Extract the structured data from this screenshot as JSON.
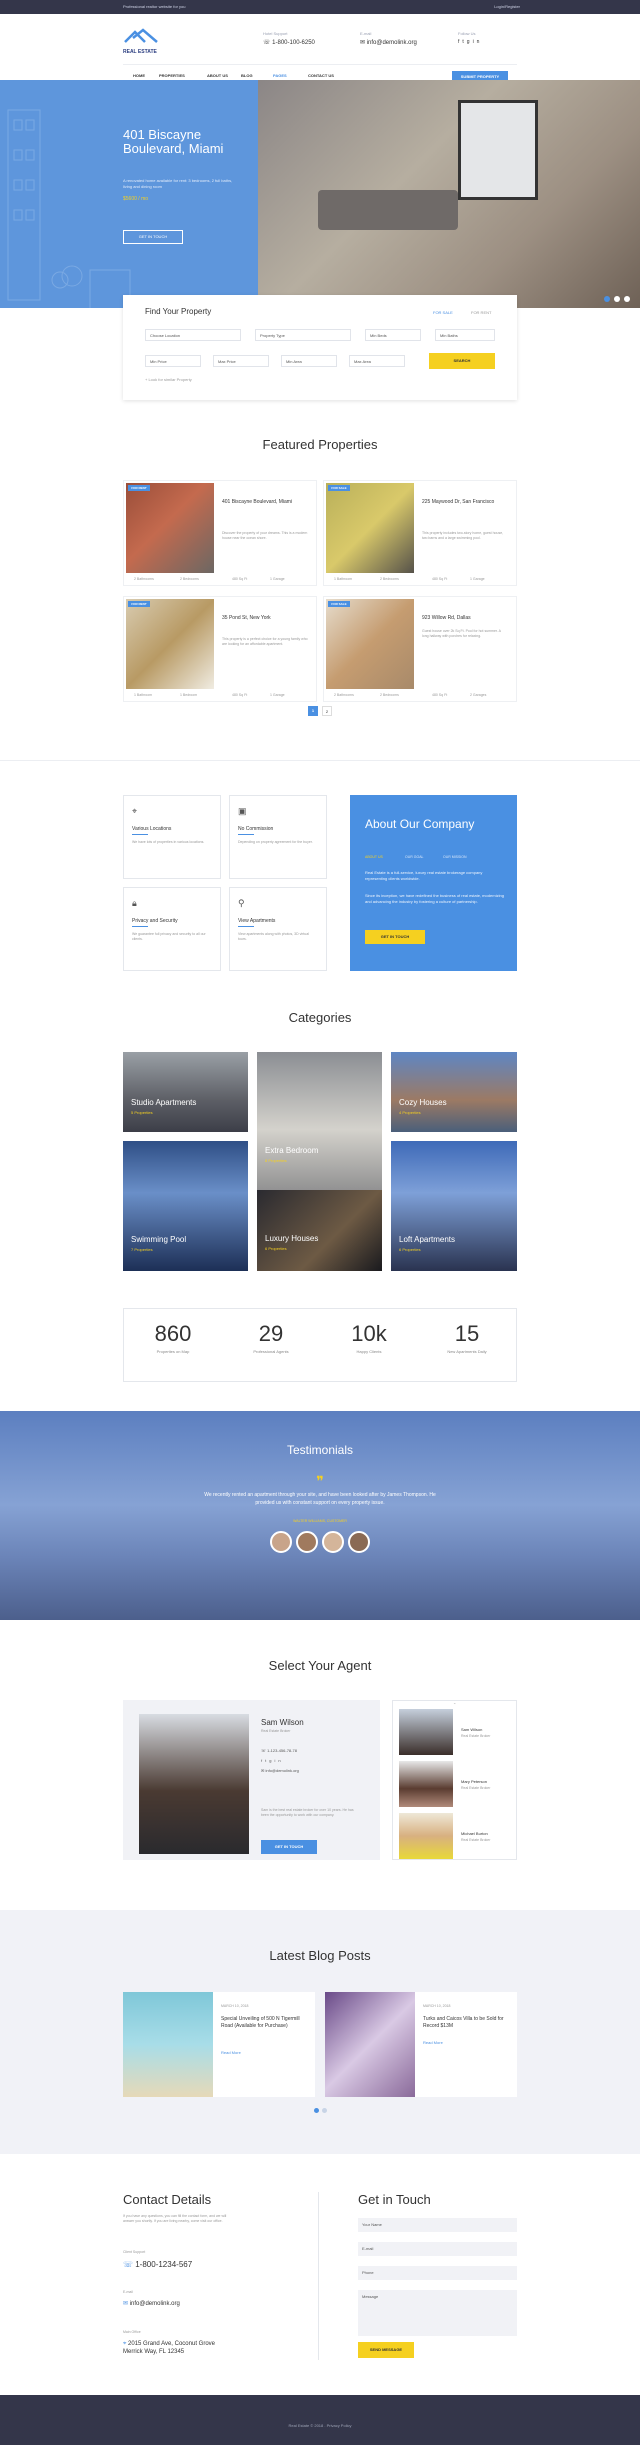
{
  "topbar": {
    "left": "Professional realtor website for you",
    "right": "Login/Register"
  },
  "header": {
    "logo": "REAL ESTATE",
    "phone_label": "Hotel Support",
    "phone": "1-800-100-6250",
    "email_label": "E-mail",
    "email": "info@demolink.org",
    "follow_label": "Follow Us",
    "nav": [
      "HOME",
      "PROPERTIES",
      "ABOUT US",
      "BLOG",
      "PAGES",
      "CONTACT US"
    ],
    "submit_button": "SUBMIT PROPERTY"
  },
  "hero": {
    "title": "401 Biscayne Boulevard, Miami",
    "desc": "A renovated home available for rent: 3 bedrooms, 2 full baths, living and dining room",
    "price": "$5600 / mo",
    "button": "GET IN TOUCH"
  },
  "search": {
    "title": "Find Your Property",
    "tab_sale": "FOR SALE",
    "tab_rent": "FOR RENT",
    "fields": [
      "Choose Location",
      "Property Type",
      "Min Beds",
      "Min Baths",
      "Min Price",
      "Max Price",
      "Min Area",
      "Max Area"
    ],
    "button": "SEARCH",
    "advanced": "Look for similar Property"
  },
  "featured": {
    "title": "Featured Properties",
    "items": [
      {
        "badge": "FOR RENT",
        "title": "401 Biscayne Boulevard, Miami",
        "desc": "Discover the property of your dreams. This is a modern house near the ocean shore.",
        "bath": "2 Bathrooms",
        "bed": "2 Bedrooms",
        "area": "480 Sq Ft",
        "garage": "1 Garage"
      },
      {
        "badge": "FOR SALE",
        "title": "225 Maywood Dr, San Francisco",
        "desc": "This property includes two-story home, guest house, two barns and a large swimming pool.",
        "bath": "1 Bathroom",
        "bed": "2 Bedrooms",
        "area": "480 Sq Ft",
        "garage": "1 Garage"
      },
      {
        "badge": "FOR RENT",
        "title": "35 Pond St, New York",
        "desc": "This property is a perfect choice for a young family who are looking for an affordable apartment.",
        "bath": "1 Bathroom",
        "bed": "1 Bedroom",
        "area": "480 Sq Ft",
        "garage": "1 Garage"
      },
      {
        "badge": "FOR SALE",
        "title": "923 Willow Rd, Dallas",
        "desc": "Guest house over 2k Sq Ft. Pool for hot summer. A long hallway with porches for relaxing.",
        "bath": "2 Bathrooms",
        "bed": "2 Bedrooms",
        "area": "480 Sq Ft",
        "garage": "2 Garages"
      }
    ],
    "pages": [
      "1",
      "2"
    ]
  },
  "features": [
    {
      "title": "Various Locations",
      "desc": "We have lots of properties in various locations."
    },
    {
      "title": "No Commission",
      "desc": "Depending on property agreement for the buyer."
    },
    {
      "title": "Privacy and Security",
      "desc": "We guarantee full privacy and security to all our clients."
    },
    {
      "title": "View Apartments",
      "desc": "View apartments along with photos, 3D virtual tours."
    }
  ],
  "about": {
    "title": "About Our Company",
    "tabs": [
      "ABOUT US",
      "OUR GOAL",
      "OUR MISSION"
    ],
    "p1": "Real Estate is a full-service, luxury real estate brokerage company representing clients worldwide.",
    "p2": "Since its inception, we have redefined the business of real estate, modernizing and advancing the industry by fostering a culture of partnership.",
    "button": "GET IN TOUCH"
  },
  "categories": {
    "title": "Categories",
    "items": [
      {
        "name": "Studio Apartments",
        "count": "5 Properties"
      },
      {
        "name": "Extra Bedroom",
        "count": "8 Properties"
      },
      {
        "name": "Cozy Houses",
        "count": "4 Properties"
      },
      {
        "name": "Swimming Pool",
        "count": "7 Properties"
      },
      {
        "name": "Luxury Houses",
        "count": "6 Properties"
      },
      {
        "name": "Loft Apartments",
        "count": "6 Properties"
      }
    ]
  },
  "stats": [
    {
      "value": "860",
      "label": "Properties on Map"
    },
    {
      "value": "29",
      "label": "Professional Agents"
    },
    {
      "value": "10k",
      "label": "Happy Clients"
    },
    {
      "value": "15",
      "label": "New Apartments Daily"
    }
  ],
  "testimonials": {
    "title": "Testimonials",
    "quote": "We recently rented an apartment through your site, and have been looked after by James Thompson. He provided us with constant support on every property issue.",
    "author": "WALTER WILLIAMS, CUSTOMER"
  },
  "agent": {
    "title": "Select Your Agent",
    "name": "Sam Wilson",
    "role": "Real Estate Broker",
    "phone": "1-123-456-78-78",
    "email": "info@demolink.org",
    "bio": "Sam is the best real estate broker for over 10 years. He has been the opportunity to work with our company.",
    "button": "GET IN TOUCH",
    "list": [
      {
        "name": "Sam Wilson",
        "role": "Real Estate Broker"
      },
      {
        "name": "Mary Peterson",
        "role": "Real Estate Broker"
      },
      {
        "name": "Michael Burton",
        "role": "Real Estate Broker"
      }
    ]
  },
  "blog": {
    "title": "Latest Blog Posts",
    "posts": [
      {
        "date": "MARCH 10, 2018",
        "title": "Special Unveiling of 500 N Tigermill Road (Available for Purchase)",
        "link": "Read More"
      },
      {
        "date": "MARCH 10, 2018",
        "title": "Turks and Caicos Villa to be Sold for Record $13M",
        "link": "Read More"
      }
    ]
  },
  "contact": {
    "title": "Contact Details",
    "desc": "If you have any questions, you can fill the contact form, and we will answer you shortly. If you are living nearby, come visit our office.",
    "support_label": "Client Support",
    "phone": "1-800-1234-567",
    "email_label": "E-mail",
    "email": "info@demolink.org",
    "office_label": "Main Office",
    "address": "2015 Grand Ave, Coconut Grove Merrick Way, FL 12345",
    "form_title": "Get in Touch",
    "fields": [
      "Your Name",
      "E-mail",
      "Phone",
      "Message"
    ],
    "button": "SEND MESSAGE"
  },
  "footer": {
    "text": "Real Estate © 2018 . Privacy Policy"
  }
}
